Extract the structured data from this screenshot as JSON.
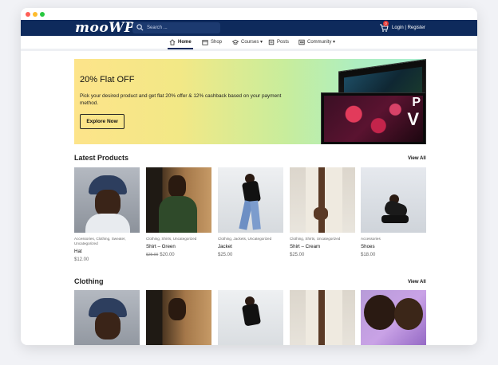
{
  "site": {
    "logo": "mooWP",
    "search_placeholder": "Search ...",
    "auth": "Login | Register",
    "cart_count": "0"
  },
  "nav": [
    {
      "label": "Home",
      "icon": "home-icon",
      "active": true
    },
    {
      "label": "Shop",
      "icon": "shop-icon"
    },
    {
      "label": "Courses ▾",
      "icon": "courses-icon"
    },
    {
      "label": "Posts",
      "icon": "posts-icon"
    },
    {
      "label": "Community ▾",
      "icon": "community-icon"
    }
  ],
  "banner": {
    "title": "20% Flat OFF",
    "text": "Pick your desired product and get flat 20% offer & 12% cashback based on your payment method.",
    "button": "Explore Now"
  },
  "latest": {
    "title": "Latest Products",
    "view_all": "View All",
    "products": [
      {
        "cats": "Accessories, Clothing, Sweater, Uncategorized",
        "name": "Hat",
        "price": "$12.00",
        "old_price": ""
      },
      {
        "cats": "Clothing, Shirts, Uncategorized",
        "name": "Shirt – Green",
        "price": "$20.00",
        "old_price": "$25.00"
      },
      {
        "cats": "Clothing, Jackets, Uncategorized",
        "name": "Jacket",
        "price": "$25.00",
        "old_price": ""
      },
      {
        "cats": "Clothing, Shirts, Uncategorized",
        "name": "Shirt – Cream",
        "price": "$25.00",
        "old_price": ""
      },
      {
        "cats": "Accessories",
        "name": "Shoes",
        "price": "$18.00",
        "old_price": ""
      }
    ]
  },
  "clothing": {
    "title": "Clothing",
    "view_all": "View All"
  }
}
